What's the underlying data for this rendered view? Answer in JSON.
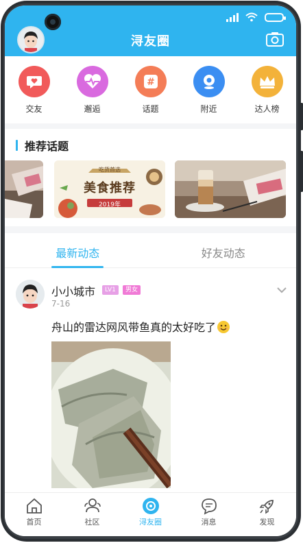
{
  "app": {
    "title": "浔友圈"
  },
  "categories": [
    {
      "label": "交友",
      "icon": "heart-chat-icon",
      "color": "#f15a5a"
    },
    {
      "label": "邂逅",
      "icon": "heartbeat-icon",
      "color": "#d96adf"
    },
    {
      "label": "话题",
      "icon": "hashtag-icon",
      "color": "#f47d57"
    },
    {
      "label": "附近",
      "icon": "location-icon",
      "color": "#3b8ef2"
    },
    {
      "label": "达人榜",
      "icon": "crown-icon",
      "color": "#f3b23a"
    }
  ],
  "topics": {
    "title": "推荐话题",
    "banner": {
      "headline": "美食推荐",
      "year": "2019年",
      "tag": "吃货首选"
    }
  },
  "tabs": [
    {
      "label": "最新动态",
      "active": true
    },
    {
      "label": "好友动态",
      "active": false
    }
  ],
  "post": {
    "username": "小小城市",
    "level_badge": "LV1",
    "gender_badge": "男女",
    "date": "7-16",
    "text": "舟山的雷达网风带鱼真的太好吃了"
  },
  "nav": [
    {
      "label": "首页",
      "icon": "home-icon",
      "active": false
    },
    {
      "label": "社区",
      "icon": "community-icon",
      "active": false
    },
    {
      "label": "浔友圈",
      "icon": "circle-icon",
      "active": true
    },
    {
      "label": "消息",
      "icon": "message-icon",
      "active": false
    },
    {
      "label": "发现",
      "icon": "rocket-icon",
      "active": false
    }
  ],
  "colors": {
    "accent": "#2fb4ef",
    "badge_level": "#e7a0e6",
    "badge_gender": "#f07ad6"
  }
}
